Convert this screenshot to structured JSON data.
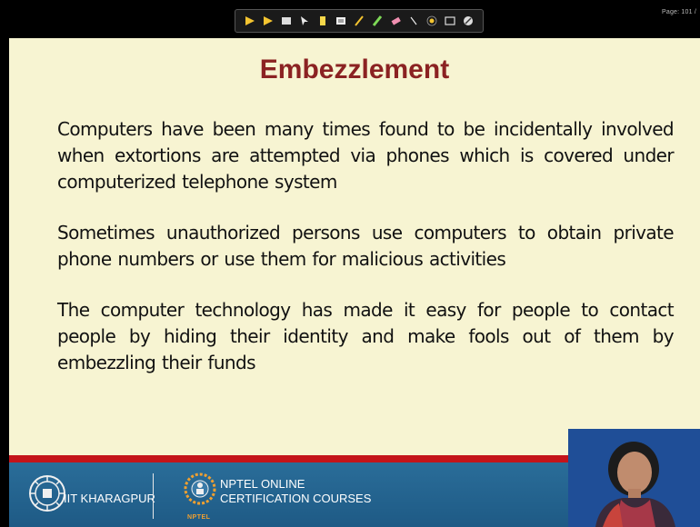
{
  "viewer": {
    "page_indicator": "Page: 101 / ",
    "toolbar_tools": [
      "next-arrow-icon",
      "prev-arrow-icon",
      "slides-icon",
      "pointer-icon",
      "highlighter-icon",
      "notes-icon",
      "pen-icon",
      "marker-icon",
      "eraser-icon",
      "cursor-icon",
      "laser-icon",
      "screen-icon",
      "menu-icon"
    ]
  },
  "slide": {
    "title": "Embezzlement",
    "paragraphs": [
      "Computers have been many times found to be incidentally involved when extortions are attempted via phones which is covered under computerized telephone system",
      "Sometimes unauthorized persons use computers to obtain private phone numbers or use  them for malicious activities",
      "The computer technology has made it easy for people to contact people by hiding their identity and make fools out of them by embezzling their funds"
    ]
  },
  "footer": {
    "institute": "IIT KHARAGPUR",
    "nptel_line1": "NPTEL ONLINE",
    "nptel_line2": "CERTIFICATION COURSES",
    "nptel_small": "NPTEL"
  },
  "colors": {
    "slide_bg": "#f7f4d2",
    "title": "#8b2222",
    "strip": "#c4141a",
    "footer": "#2a6d99",
    "video_bg": "#1f4e97"
  }
}
